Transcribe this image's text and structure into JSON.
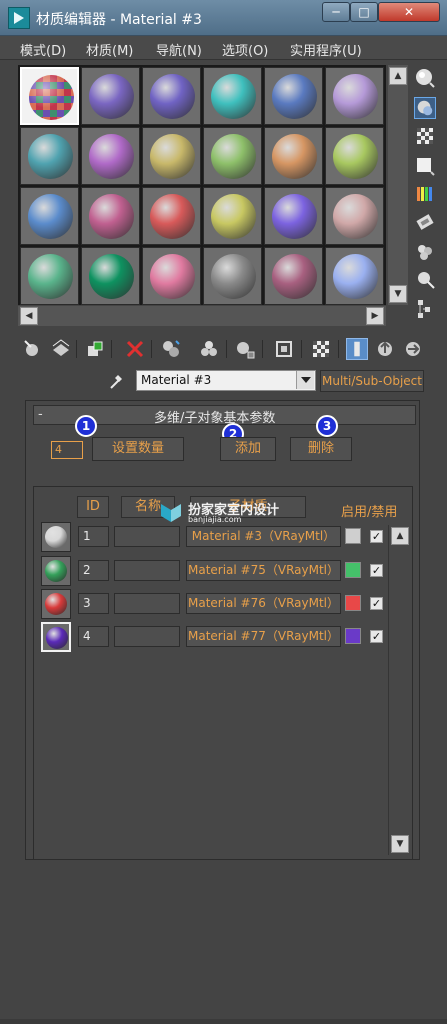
{
  "window": {
    "title": "材质编辑器 - Material #3",
    "minimize": "─",
    "maximize": "□",
    "close": "✕"
  },
  "menu": [
    {
      "label": "模式(D)"
    },
    {
      "label": "材质(M)"
    },
    {
      "label": "导航(N)"
    },
    {
      "label": "选项(O)"
    },
    {
      "label": "实用程序(U)"
    }
  ],
  "slots": [
    [
      "checker",
      "#7a66c2",
      "#7063c4",
      "#3fc0be",
      "#5a7ac0",
      "#b59ad8"
    ],
    [
      "#50a3b0",
      "#b06ac8",
      "#c8b86a",
      "#8ec06a",
      "#d69663",
      "#a8c860"
    ],
    [
      "#5b8ccc",
      "#c06090",
      "#d85a5a",
      "#c8c862",
      "#7c63e0",
      "#d0a8a8"
    ],
    [
      "#5ab48c",
      "#0e9260",
      "#e07aa0",
      "#8a8a8a",
      "#a86080",
      "#9ab0f0"
    ]
  ],
  "name_row": {
    "material_name": "Material #3",
    "type_button": "Multi/Sub-Object"
  },
  "rollout": {
    "minus": "-",
    "title": "多维/子对象基本参数",
    "count": "4",
    "set_count_label": "设置数量",
    "add_label": "添加",
    "delete_label": "删除",
    "badges": [
      "1",
      "2",
      "3"
    ]
  },
  "list": {
    "id_header": "ID",
    "name_header": "名称",
    "submat_header": "子材质",
    "enable_header": "启用/禁用",
    "watermark_text": "扮家家室内设计",
    "watermark_sub": "banjiajia.com",
    "rows": [
      {
        "id": "1",
        "material": "Material #3（VRayMtl）",
        "color": "#cfcfcf",
        "sphere": "#d8d8d8",
        "checked": "✓"
      },
      {
        "id": "2",
        "material": "Material #75（VRayMtl）",
        "color": "#45c06a",
        "sphere": "#34a05a",
        "checked": "✓"
      },
      {
        "id": "3",
        "material": "Material #76（VRayMtl）",
        "color": "#e84848",
        "sphere": "#d83a3a",
        "checked": "✓"
      },
      {
        "id": "4",
        "material": "Material #77（VRayMtl）",
        "color": "#6a3ac8",
        "sphere": "#5a2ab8",
        "checked": "✓"
      }
    ]
  },
  "colors": {
    "accent": "#e8a04a",
    "badge": "#1f2fd6",
    "background": "#444444"
  }
}
